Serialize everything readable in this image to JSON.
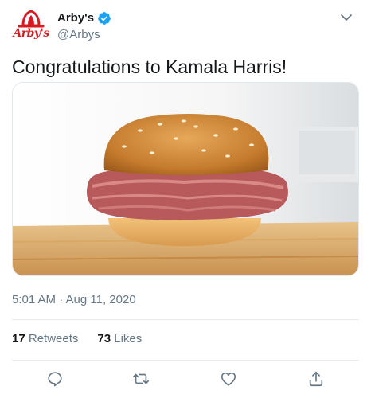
{
  "tweet": {
    "author": {
      "display_name": "Arby's",
      "handle": "@Arbys",
      "avatar_text": "Arby's",
      "verified": true
    },
    "text": "Congratulations to Kamala Harris!",
    "media": {
      "alt": "Roast beef sandwich on a wooden board",
      "icon": "photo"
    },
    "timestamp": "5:01 AM · Aug 11, 2020",
    "stats": {
      "retweets_count": "17",
      "retweets_label": "Retweets",
      "likes_count": "73",
      "likes_label": "Likes"
    },
    "actions": [
      "reply-icon",
      "retweet-icon",
      "like-icon",
      "share-icon"
    ]
  },
  "colors": {
    "brand_red": "#d71920",
    "verified_blue": "#1da1f2",
    "secondary_text": "#657786",
    "primary_text": "#14171a"
  }
}
